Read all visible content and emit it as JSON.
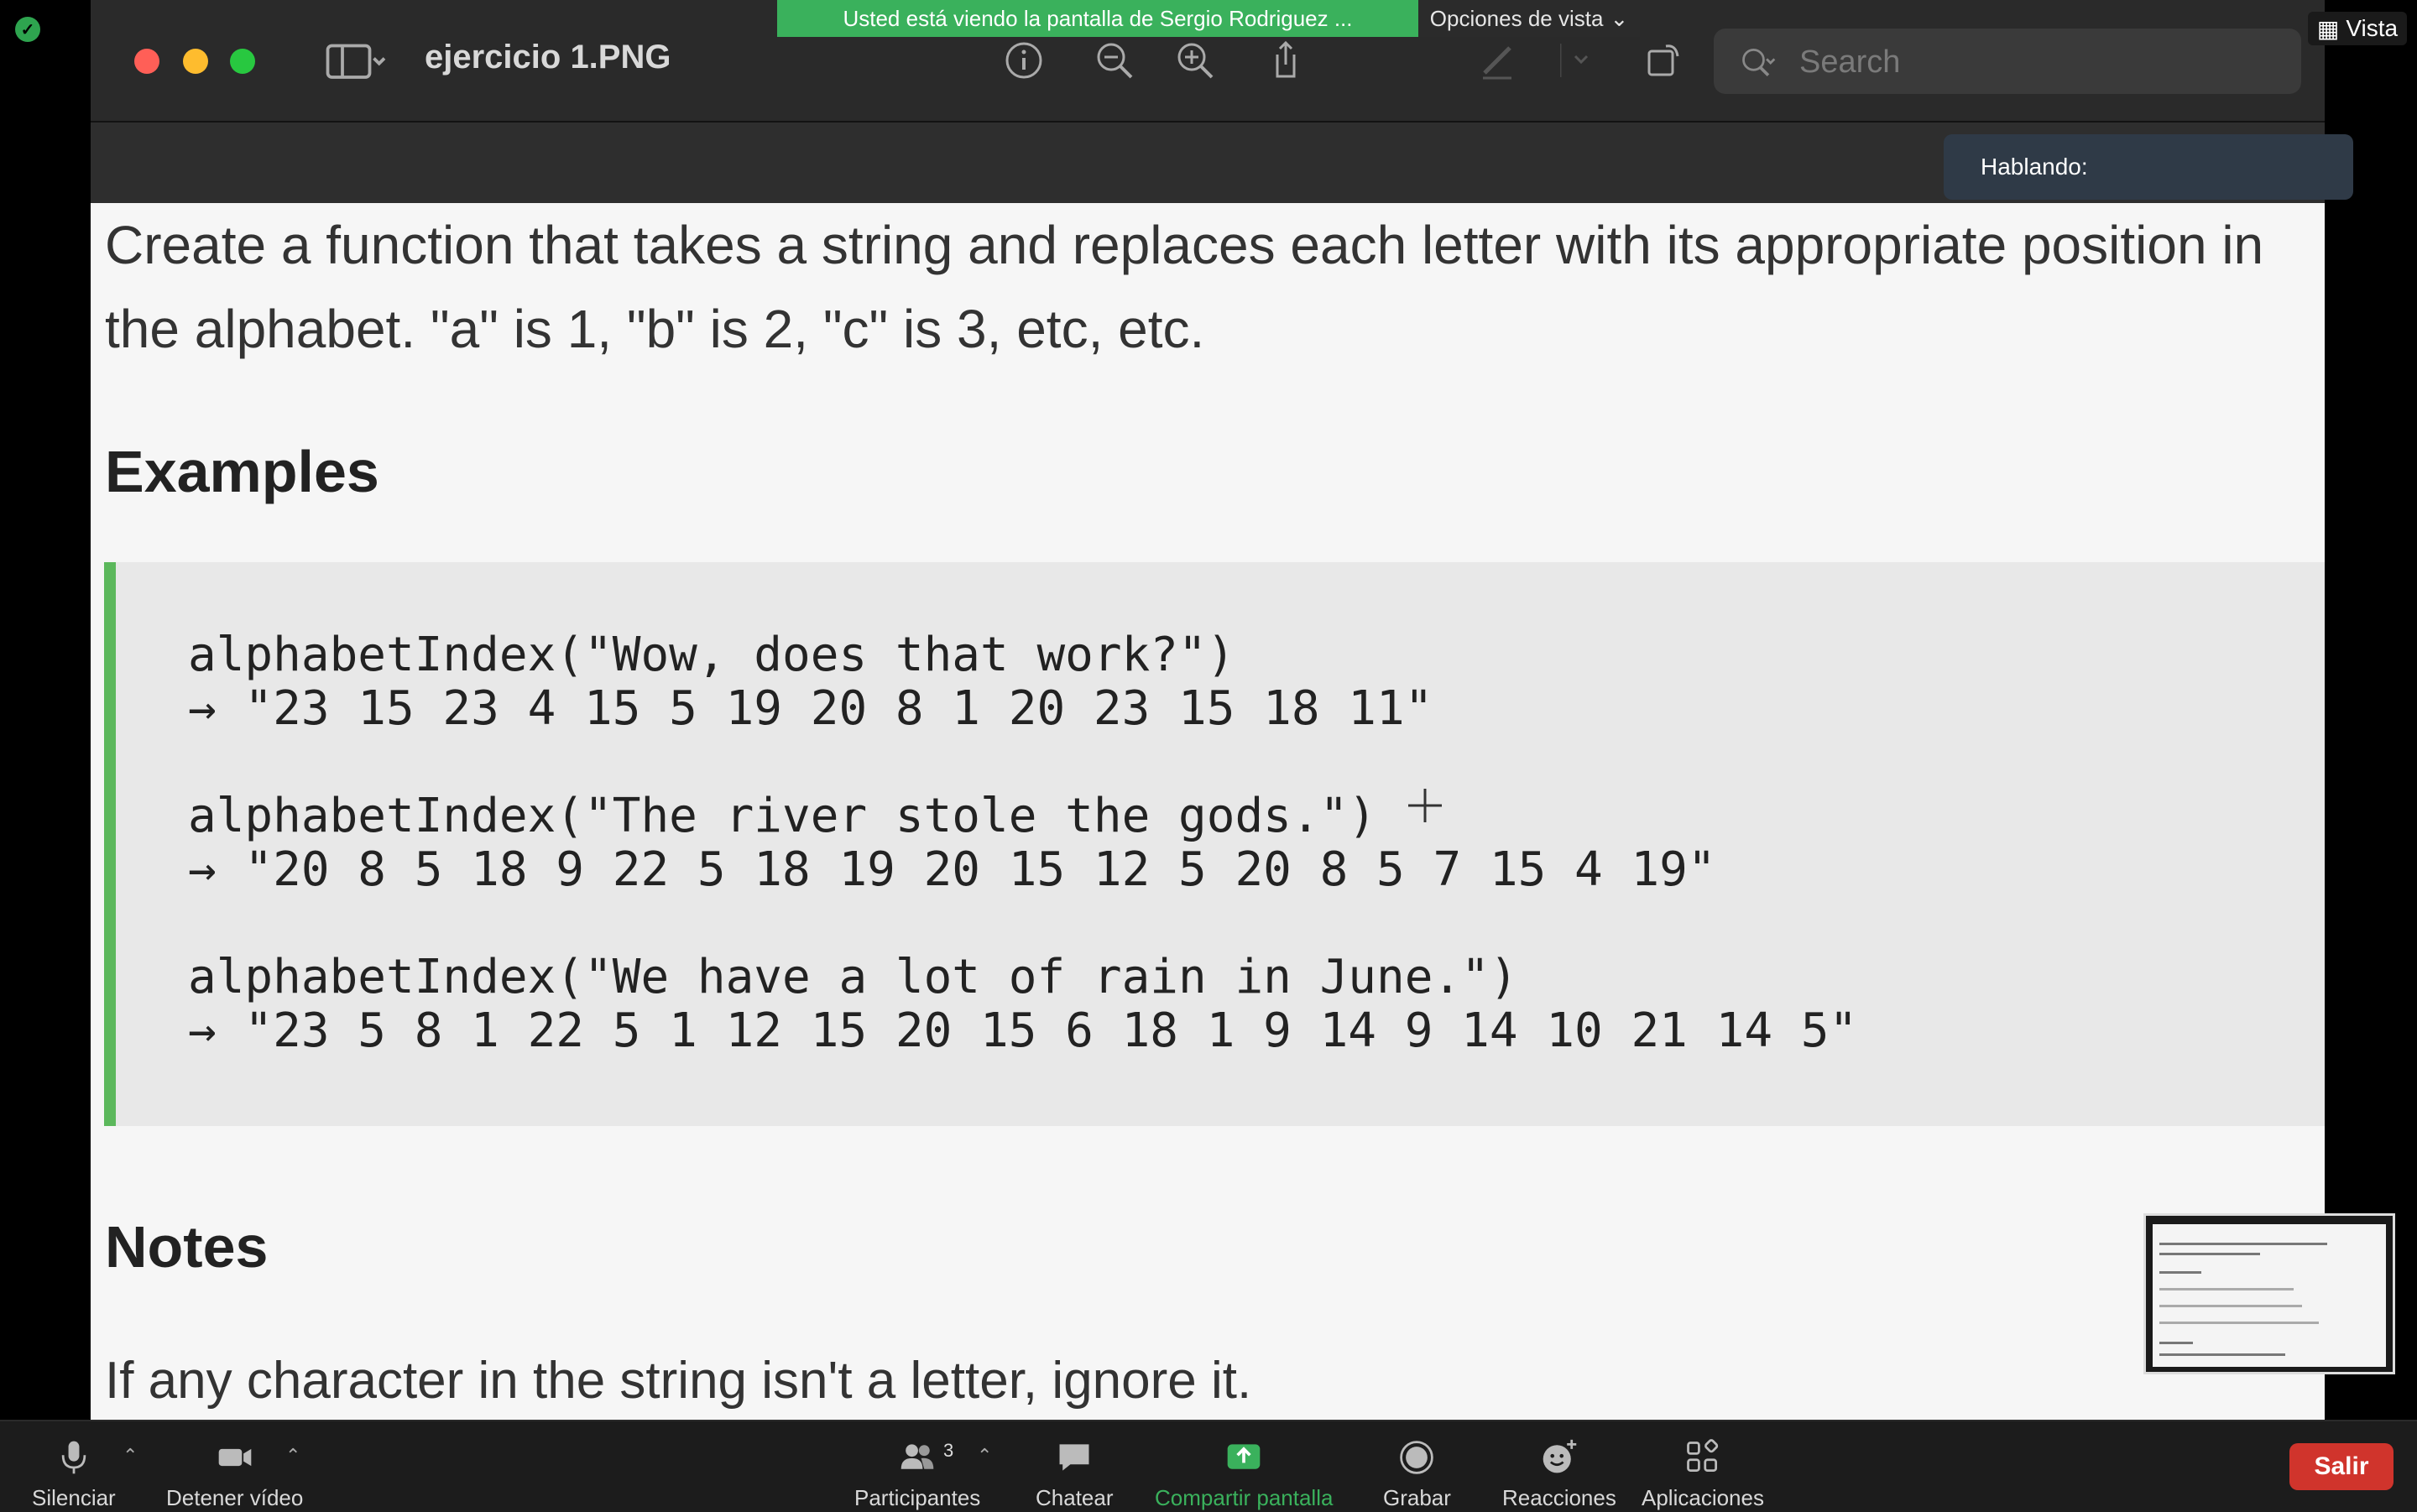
{
  "overlay": {
    "share_banner": "Usted está viendo la pantalla de Sergio Rodriguez ...",
    "view_options": "Opciones de vista",
    "view_button": "Vista",
    "speaking": "Hablando:"
  },
  "window": {
    "title": "ejercicio 1.PNG",
    "search_placeholder": "Search"
  },
  "document": {
    "description": "Create a function that takes a string and replaces each letter with its appropriate position in the alphabet. \"a\" is 1, \"b\" is 2, \"c\" is 3, etc, etc.",
    "examples_heading": "Examples",
    "examples": [
      {
        "call": "alphabetIndex(\"Wow, does that work?\")",
        "result": "→ \"23 15 23 4 15 5 19 20 8 1 20 23 15 18 11\""
      },
      {
        "call": "alphabetIndex(\"The river stole the gods.\")",
        "result": "→ \"20 8 5 18 9 22 5 18 19 20 15 12 5 20 8 5 7 15 4 19\""
      },
      {
        "call": "alphabetIndex(\"We have a lot of rain in June.\")",
        "result": "→ \"23 5 8 1 22 5 1 12 15 20 15 6 18 1 9 14 9 14 10 21 14 5\""
      }
    ],
    "notes_heading": "Notes",
    "note": "If any character in the string isn't a letter, ignore it."
  },
  "toolbar": {
    "mute": "Silenciar",
    "stop_video": "Detener vídeo",
    "participants": "Participantes",
    "participants_count": "3",
    "chat": "Chatear",
    "share": "Compartir pantalla",
    "record": "Grabar",
    "reactions": "Reacciones",
    "apps": "Aplicaciones",
    "leave": "Salir"
  },
  "colors": {
    "share_green": "#3ab15c",
    "leave_red": "#d0342c",
    "code_accent": "#5cb85c"
  }
}
